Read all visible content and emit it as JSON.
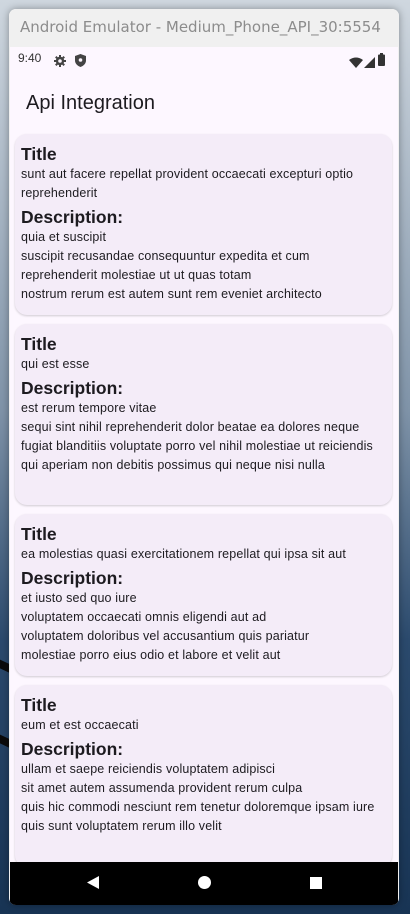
{
  "window": {
    "title": "Android Emulator - Medium_Phone_API_30:5554"
  },
  "status_bar": {
    "time": "9:40",
    "icons": [
      "gear-icon",
      "shield-icon",
      "wifi-icon",
      "signal-icon",
      "battery-icon"
    ]
  },
  "app_bar": {
    "title": "Api Integration"
  },
  "posts": [
    {
      "title_label": "Title",
      "title": "sunt aut facere repellat provident occaecati excepturi optio reprehenderit",
      "description_label": "Description:",
      "body": "quia et suscipit\nsuscipit recusandae consequuntur expedita et cum reprehenderit molestiae ut ut quas totam\nnostrum rerum est autem sunt rem eveniet architecto"
    },
    {
      "title_label": "Title",
      "title": "qui est esse",
      "description_label": "Description:",
      "body": "est rerum tempore vitae\nsequi sint nihil reprehenderit dolor beatae ea dolores neque fugiat blanditiis voluptate porro vel nihil molestiae ut reiciendis\nqui aperiam non debitis possimus qui neque nisi nulla"
    },
    {
      "title_label": "Title",
      "title": "ea molestias quasi exercitationem repellat qui ipsa sit aut",
      "description_label": "Description:",
      "body": "et iusto sed quo iure\nvoluptatem occaecati omnis eligendi aut ad\nvoluptatem doloribus vel accusantium quis pariatur\nmolestiae porro eius odio et labore et velit aut"
    },
    {
      "title_label": "Title",
      "title": "eum et est occaecati",
      "description_label": "Description:",
      "body": "ullam et saepe reiciendis voluptatem adipisci\nsit amet autem assumenda provident rerum culpa\nquis hic commodi nesciunt rem tenetur doloremque ipsam iure\nquis sunt voluptatem rerum illo velit"
    }
  ],
  "nav_bar": {
    "buttons": [
      "back-icon",
      "home-icon",
      "recents-icon"
    ]
  },
  "colors": {
    "screen_background": "#fdf7ff",
    "card_background": "#f4ecf8",
    "text": "#1d1b20",
    "nav_bar": "#000000"
  }
}
